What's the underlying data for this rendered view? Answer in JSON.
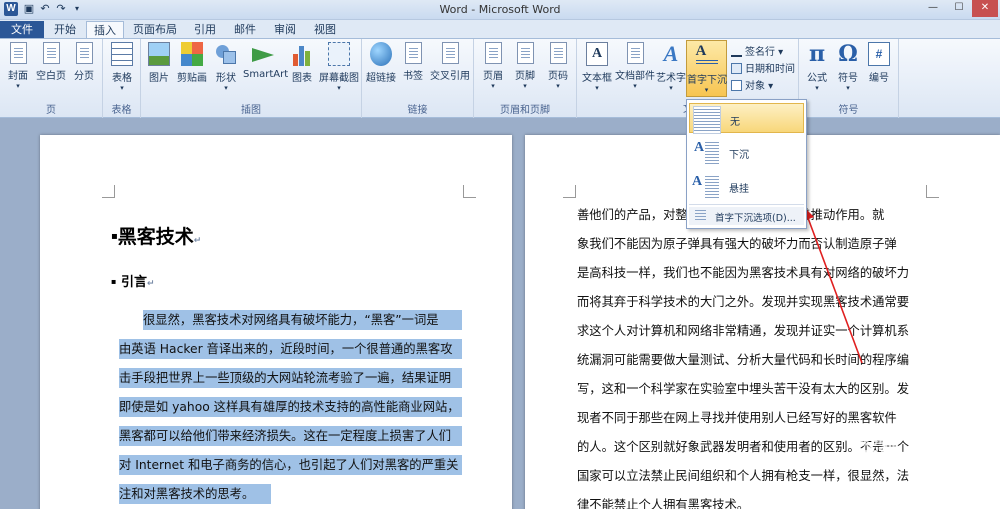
{
  "window": {
    "title": "Word - Microsoft Word",
    "app_icon": "W"
  },
  "tabs": [
    "文件",
    "开始",
    "插入",
    "页面布局",
    "引用",
    "邮件",
    "审阅",
    "视图"
  ],
  "ribbon": {
    "groups": [
      {
        "label": "页",
        "buttons": [
          "封面",
          "空白页",
          "分页"
        ]
      },
      {
        "label": "表格",
        "buttons": [
          "表格"
        ]
      },
      {
        "label": "插图",
        "buttons": [
          "图片",
          "剪贴画",
          "形状",
          "SmartArt",
          "图表",
          "屏幕截图"
        ]
      },
      {
        "label": "链接",
        "buttons": [
          "超链接",
          "书签",
          "交叉引用"
        ]
      },
      {
        "label": "页眉和页脚",
        "buttons": [
          "页眉",
          "页脚",
          "页码"
        ]
      },
      {
        "label": "文",
        "buttons": [
          "文本框",
          "文档部件",
          "艺术字",
          "首字下沉"
        ],
        "small": [
          "签名行",
          "日期和时间",
          "对象"
        ]
      },
      {
        "label": "符号",
        "buttons": [
          "公式",
          "符号",
          "编号"
        ]
      }
    ]
  },
  "dropdown": {
    "items": [
      "无",
      "下沉",
      "悬挂"
    ],
    "options": "首字下沉选项(D)..."
  },
  "page1": {
    "title": "黑客技术",
    "subtitle": "引言",
    "lines": [
      "很显然，黑客技术对网络具有破坏能力，“黑客”一词是",
      "由英语 Hacker 音译出来的，近段时间，一个很普通的黑客攻",
      "击手段把世界上一些顶级的大网站轮流考验了一遍，结果证明",
      "即使是如 yahoo 这样具有雄厚的技术支持的高性能商业网站，",
      "黑客都可以给他们带来经济损失。这在一定程度上损害了人们",
      "对 Internet 和电子商务的信心，也引起了人们对黑客的严重关",
      "注和对黑客技术的思考。"
    ]
  },
  "page2": {
    "lines": [
      "善他们的产品，对整个网络的发展一直起着推动作用。就",
      "象我们不能因为原子弹具有强大的破坏力而否认制造原子弹",
      "是高科技一样，我们也不能因为黑客技术具有对网络的破坏力",
      "而将其弃于科学技术的大门之外。发现并实现黑客技术通常要",
      "求这个人对计算机和网络非常精通，发现并证实一个计算机系",
      "统漏洞可能需要做大量测试、分析大量代码和长时间的程序编",
      "写，这和一个科学家在实验室中埋头苦干没有太大的区别。发",
      "现者不同于那些在网上寻找并使用别人已经写好的黑客软件",
      "的人。这个区别就好象武器发明者和使用者的区别。不是一个",
      "国家可以立法禁止民间组织和个人拥有枪支一样，很显然，法",
      "律不能禁止个人拥有黑客技术。"
    ]
  },
  "watermark": "经验"
}
